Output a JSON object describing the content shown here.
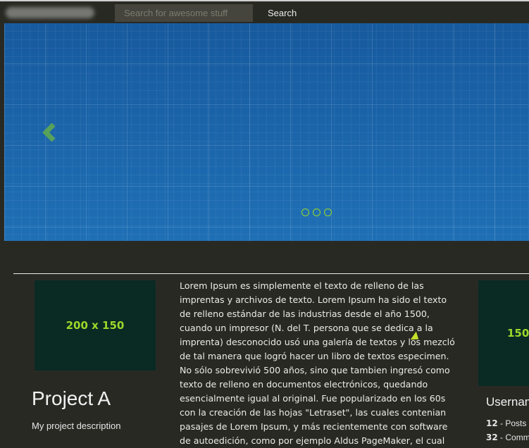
{
  "header": {
    "search_placeholder": "Search for awesome stuff",
    "search_value": "",
    "search_button": "Search"
  },
  "slider": {
    "prev_icon": "chevron-left-icon",
    "dot_count": 3,
    "accent_color": "#9bd82a"
  },
  "project": {
    "thumb_label": "200 x 150",
    "title": "Project A",
    "description": "My project description"
  },
  "body_lines": [
    "Lorem Ipsum es simplemente el texto de relleno de las",
    "imprentas y archivos de texto. Lorem Ipsum ha sido el texto",
    "de relleno estándar de las industrias desde el año 1500,",
    "cuando un impresor (N. del T. persona que se dedica a la",
    "imprenta) desconocido usó una galería de textos y los mezcló",
    "de tal manera que logró hacer un libro de textos especimen.",
    "No sólo sobrevivió 500 años, sino que tambien ingresó como",
    "texto de relleno en documentos electrónicos, quedando",
    "esencialmente igual al original. Fue popularizado en los 60s",
    "con la creación de las hojas \"Letraset\", las cuales contenian",
    "pasajes de Lorem Ipsum, y más recientemente con software",
    "de autoedición, como por ejemplo Aldus PageMaker, el cual"
  ],
  "user": {
    "thumb_label": "150 x",
    "name": "Usernam",
    "stats": [
      {
        "count": "12",
        "label": "Posts"
      },
      {
        "count": "32",
        "label": "Comm"
      }
    ]
  }
}
